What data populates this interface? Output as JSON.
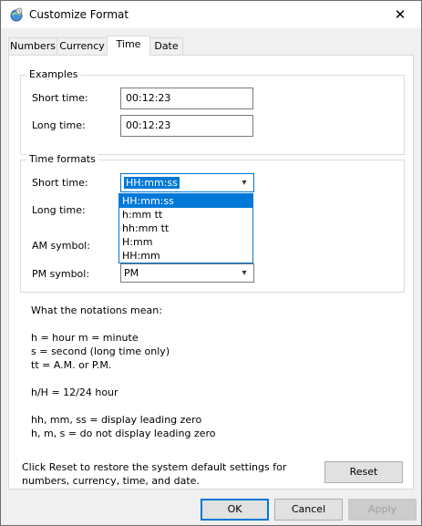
{
  "window": {
    "title": "Customize Format"
  },
  "tabs": [
    {
      "label": "Numbers"
    },
    {
      "label": "Currency"
    },
    {
      "label": "Time"
    },
    {
      "label": "Date"
    }
  ],
  "examples": {
    "group_title": "Examples",
    "short_label": "Short time:",
    "short_value": "00:12:23",
    "long_label": "Long time:",
    "long_value": "00:12:23"
  },
  "time_formats": {
    "group_title": "Time formats",
    "short_label": "Short time:",
    "short_value": "HH:mm:ss",
    "long_label": "Long time:",
    "am_label": "AM symbol:",
    "pm_label": "PM symbol:",
    "pm_value": "PM",
    "dropdown_options": [
      "HH:mm:ss",
      "h:mm tt",
      "hh:mm tt",
      "H:mm",
      "HH:mm"
    ],
    "selected_option": "HH:mm:ss"
  },
  "notations": {
    "heading": "What the notations mean:",
    "lines": [
      "h = hour   m = minute",
      "s = second (long time only)",
      "tt = A.M. or P.M.",
      "h/H = 12/24 hour",
      "hh, mm, ss = display leading zero",
      "h, m, s = do not display leading zero"
    ]
  },
  "reset": {
    "text_line1": "Click Reset to restore the system default settings for",
    "text_line2": "numbers, currency, time, and date.",
    "button_label": "Reset"
  },
  "buttons": {
    "ok": "OK",
    "cancel": "Cancel",
    "apply": "Apply"
  },
  "colors": {
    "accent": "#0078d7",
    "disabled_text": "#a0a0a0"
  }
}
